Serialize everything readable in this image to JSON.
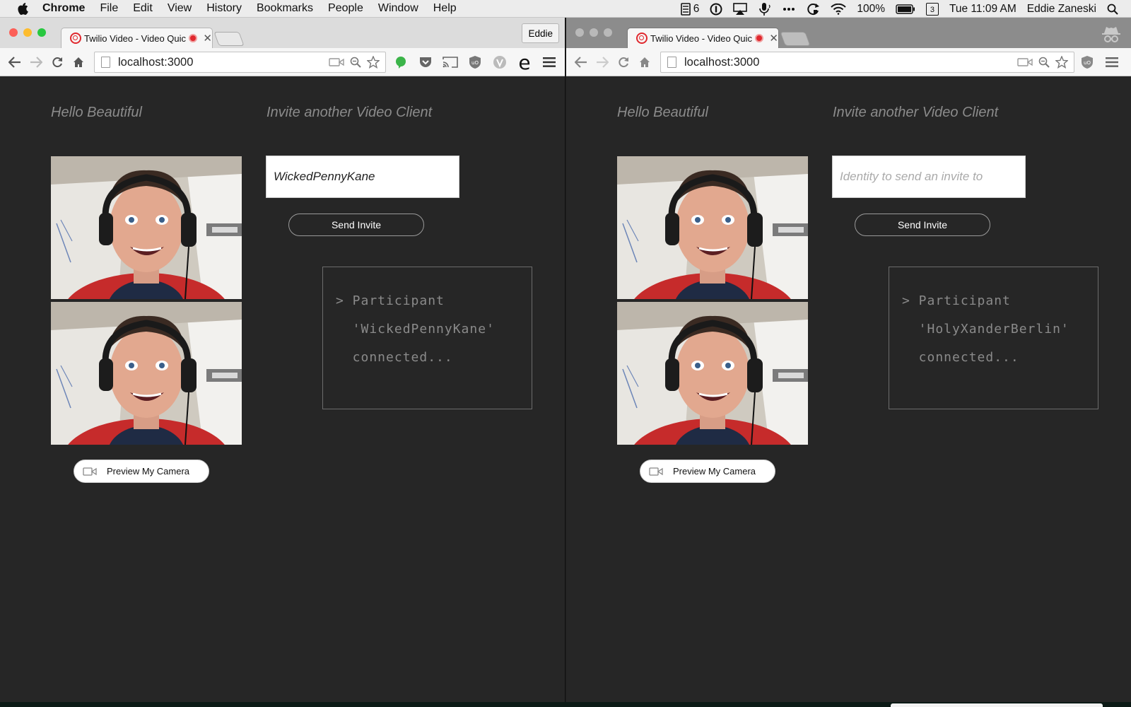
{
  "menubar": {
    "app": "Chrome",
    "items": [
      "File",
      "Edit",
      "View",
      "History",
      "Bookmarks",
      "People",
      "Window",
      "Help"
    ],
    "status": {
      "badge_count": "6",
      "battery": "100%",
      "calendar_day": "3",
      "clock": "Tue 11:09 AM",
      "user": "Eddie Zaneski"
    },
    "icons": [
      "apple-logo-icon",
      "notes-count-icon",
      "1password-icon",
      "airplay-icon",
      "microphone-icon",
      "more-icon",
      "sync-icon",
      "wifi-icon",
      "battery-icon",
      "calendar-icon",
      "spotlight-search-icon"
    ]
  },
  "left_window": {
    "tab_title": "Twilio Video - Video Quickstart",
    "profile_label": "Eddie",
    "url": "localhost:3000",
    "extensions": [
      "grammarly-icon",
      "pocket-icon",
      "cast-icon",
      "ublock-icon",
      "vimium-icon",
      "e-extension-icon",
      "chrome-menu-icon"
    ],
    "greeting": "Hello Beautiful",
    "invite_heading": "Invite another Video Client",
    "invite_value": "WickedPennyKane",
    "invite_placeholder": "Identity to send an invite to",
    "send_label": "Send Invite",
    "log_lines": [
      "> Participant",
      "  'WickedPennyKane'",
      "  connected..."
    ],
    "preview_label": "Preview My Camera"
  },
  "right_window": {
    "tab_title": "Twilio Video - Video Quickstart",
    "url": "localhost:3000",
    "incognito": true,
    "extensions": [
      "ublock-icon",
      "chrome-menu-icon"
    ],
    "greeting": "Hello Beautiful",
    "invite_heading": "Invite another Video Client",
    "invite_value": "",
    "invite_placeholder": "Identity to send an invite to",
    "send_label": "Send Invite",
    "log_lines": [
      "> Participant",
      "  'HolyXanderBerlin'",
      "  connected..."
    ],
    "preview_label": "Preview My Camera"
  },
  "colors": {
    "page_bg": "#262626",
    "accent_red": "#e0282e",
    "light_close": "#fc5f57",
    "light_min": "#fdbc2e",
    "light_max": "#28c840"
  }
}
